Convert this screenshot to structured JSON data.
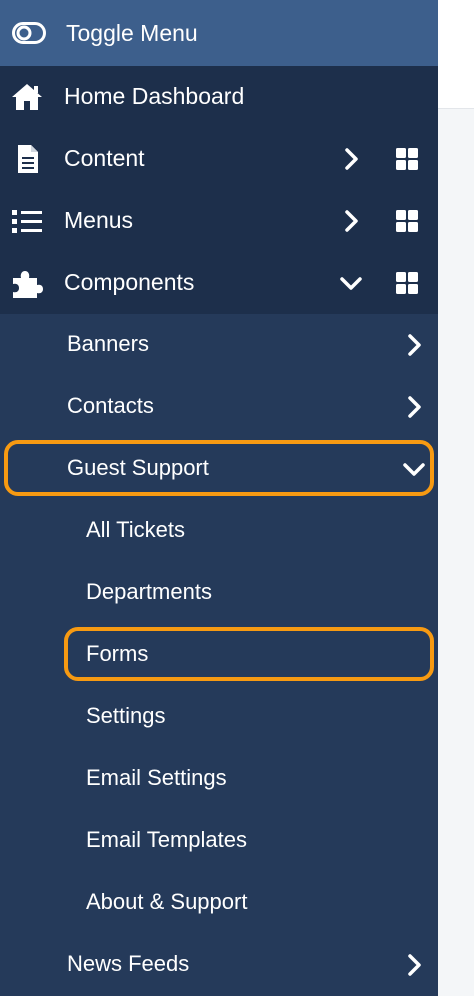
{
  "sidebar": {
    "toggle_label": "Toggle Menu",
    "top_items": [
      {
        "label": "Home Dashboard",
        "icon": "home-icon"
      },
      {
        "label": "Content",
        "icon": "file-icon",
        "expanded": false
      },
      {
        "label": "Menus",
        "icon": "list-icon",
        "expanded": false
      },
      {
        "label": "Components",
        "icon": "puzzle-icon",
        "expanded": true
      }
    ],
    "components": {
      "items": [
        {
          "label": "Banners",
          "expanded": false
        },
        {
          "label": "Contacts",
          "expanded": false
        },
        {
          "label": "Guest Support",
          "expanded": true,
          "highlighted": true
        }
      ],
      "guest_support_items": [
        {
          "label": "All Tickets"
        },
        {
          "label": "Departments"
        },
        {
          "label": "Forms",
          "highlighted": true
        },
        {
          "label": "Settings"
        },
        {
          "label": "Email Settings"
        },
        {
          "label": "Email Templates"
        },
        {
          "label": "About & Support"
        }
      ],
      "after_items": [
        {
          "label": "News Feeds",
          "expanded": false
        }
      ]
    }
  },
  "colors": {
    "sidebar_bg": "#253a5a",
    "top_group_bg": "#1d2f4b",
    "toggle_bg": "#3d5f8c",
    "highlight": "#f79a12",
    "text": "#ffffff"
  }
}
